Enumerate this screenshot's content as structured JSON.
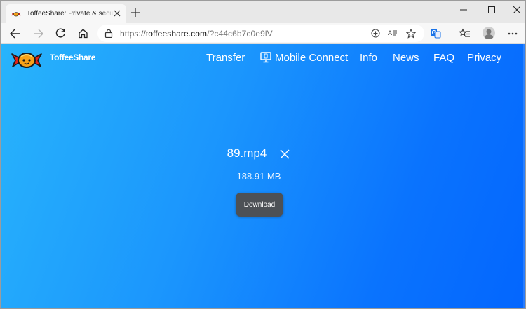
{
  "browser": {
    "tab": {
      "title": "ToffeeShare: Private & secure file sharing"
    },
    "address_bar": {
      "scheme": "https://",
      "host": "toffeeshare.com",
      "path": "/?c44c6b7c0e9lV"
    },
    "icons": {
      "back": "back-arrow-icon",
      "forward": "forward-arrow-icon",
      "refresh": "refresh-icon",
      "home": "home-icon",
      "lock": "lock-icon",
      "add_to_page": "add-icon",
      "read_aloud": "read-aloud-icon",
      "favorite": "star-icon",
      "translate": "translate-icon",
      "favorites": "favorites-icon",
      "profile": "profile-icon",
      "menu": "more-icon"
    }
  },
  "site": {
    "brand": "ToffeeShare",
    "nav": [
      {
        "label": "Transfer"
      },
      {
        "label": "Mobile Connect"
      },
      {
        "label": "Info"
      },
      {
        "label": "News"
      },
      {
        "label": "FAQ"
      },
      {
        "label": "Privacy"
      }
    ]
  },
  "file": {
    "name": "89.mp4",
    "size": "188.91 MB",
    "download_label": "Download"
  },
  "colors": {
    "gradient_start": "#28b4fb",
    "gradient_end": "#0366fe",
    "button_bg": "#4d5156",
    "candy_orange": "#f7a21b"
  }
}
